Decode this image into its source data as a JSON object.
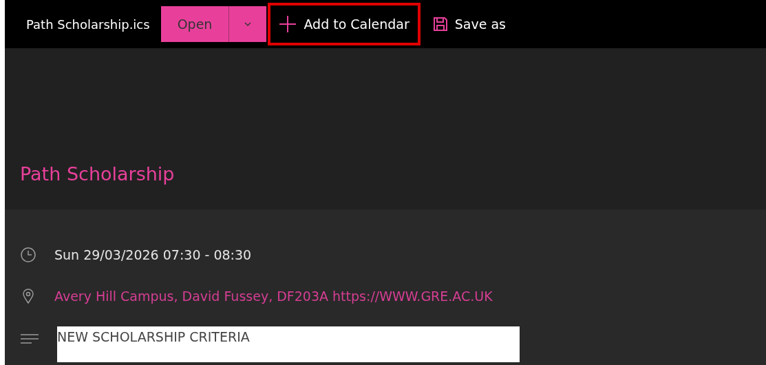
{
  "file_name": "Path Scholarship.ics",
  "open_button": {
    "label": "Open"
  },
  "actions": [
    {
      "kind": "add",
      "label": "Add to Calendar",
      "highlighted": true
    },
    {
      "kind": "save",
      "label": "Save as",
      "highlighted": false
    }
  ],
  "event": {
    "title": "Path Scholarship",
    "time": "Sun 29/03/2026 07:30 - 08:30",
    "location": "Avery Hill Campus, David Fussey, DF203A https://WWW.GRE.AC.UK",
    "description": "NEW SCHOLARSHIP CRITERIA"
  }
}
